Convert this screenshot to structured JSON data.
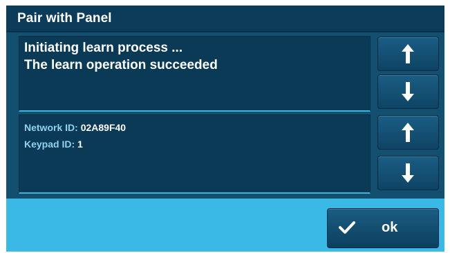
{
  "window": {
    "title": "Pair with Panel"
  },
  "messages": {
    "lines": [
      "Initiating learn process ...",
      "The learn operation succeeded"
    ]
  },
  "info": {
    "network_label": "Network ID:",
    "network_value": "02A89F40",
    "keypad_label": "Keypad ID:",
    "keypad_value": "1"
  },
  "buttons": {
    "ok_label": "ok",
    "up_icon": "arrow-up-icon",
    "down_icon": "arrow-down-icon",
    "ok_icon": "checkmark-icon"
  },
  "colors": {
    "background": "#3ab8e6",
    "title_bar": "#0c3c5a",
    "panel": "#135070",
    "box": "#0a3a56",
    "info_label": "#8fd3f0"
  }
}
